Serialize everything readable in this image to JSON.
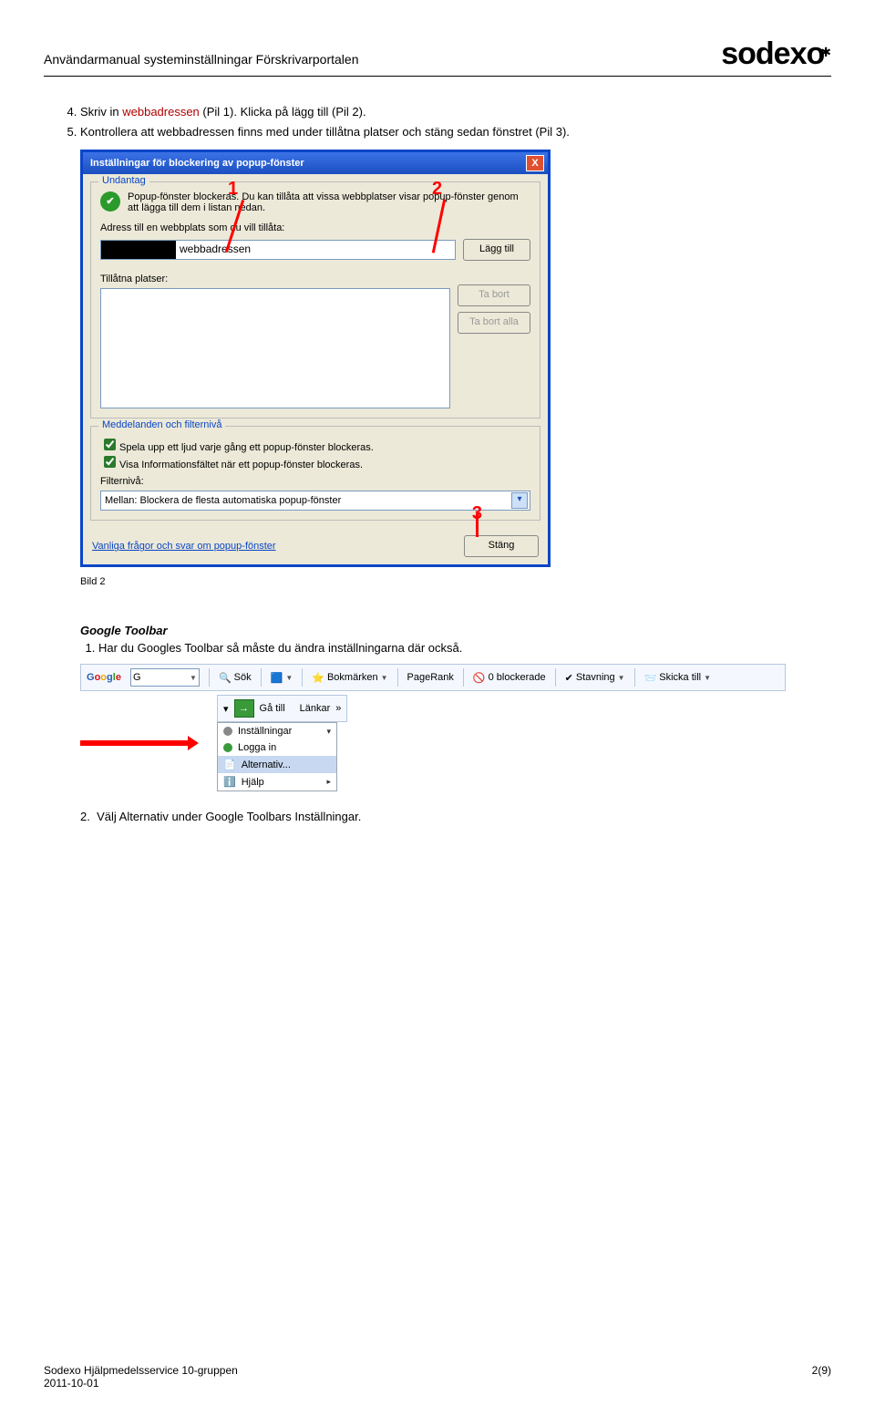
{
  "header": {
    "title": "Användarmanual systeminställningar Förskrivarportalen",
    "brand": "sodexo"
  },
  "intro": {
    "line1_prefix": "Skriv in ",
    "line1_link": "webbadressen",
    "line1_suffix": " (Pil 1). Klicka på lägg till (Pil 2).",
    "line2": "Kontrollera att webbadressen finns med under tillåtna platser och stäng sedan fönstret (Pil 3)."
  },
  "dialog": {
    "title": "Inställningar för blockering av popup-fönster",
    "group1_legend": "Undantag",
    "info_text": "Popup-fönster blockeras. Du kan tillåta att vissa webbplatser visar popup-fönster genom att lägga till dem i listan nedan.",
    "address_label": "Adress till en webbplats som du vill tillåta:",
    "typed": "webbadressen",
    "add_btn": "Lägg till",
    "allowed_label": "Tillåtna platser:",
    "remove_btn": "Ta bort",
    "remove_all_btn": "Ta bort alla",
    "group2_legend": "Meddelanden och filternivå",
    "cb1": "Spela upp ett ljud varje gång ett popup-fönster blockeras.",
    "cb2": "Visa Informationsfältet när ett popup-fönster blockeras.",
    "filter_label": "Filternivå:",
    "filter_value": "Mellan: Blockera de flesta automatiska popup-fönster",
    "faq_link": "Vanliga frågor och svar om popup-fönster",
    "close_btn": "Stäng",
    "bild_caption": "Bild 2",
    "n1": "1",
    "n2": "2",
    "n3": "3"
  },
  "gtb": {
    "heading": "Google Toolbar",
    "step1": "Har du Googles Toolbar så måste du ändra inställningarna där också.",
    "step2": "Välj Alternativ under Google Toolbars Inställningar.",
    "toolbar": {
      "g_prefix": "G",
      "search_btn": "Sök",
      "bookmarks": "Bokmärken",
      "pagerank": "PageRank",
      "blocked": "0 blockerade",
      "spelling": "Stavning",
      "send": "Skicka till"
    },
    "iebits": {
      "go": "Gå till",
      "links": "Länkar",
      "chev": "»",
      "m_settings": "Inställningar",
      "m_login": "Logga in",
      "m_alt": "Alternativ...",
      "m_help": "Hjälp"
    }
  },
  "footer": {
    "left_line1": "Sodexo Hjälpmedelsservice 10-gruppen",
    "left_line2": "2011-10-01",
    "right": "2(9)"
  }
}
